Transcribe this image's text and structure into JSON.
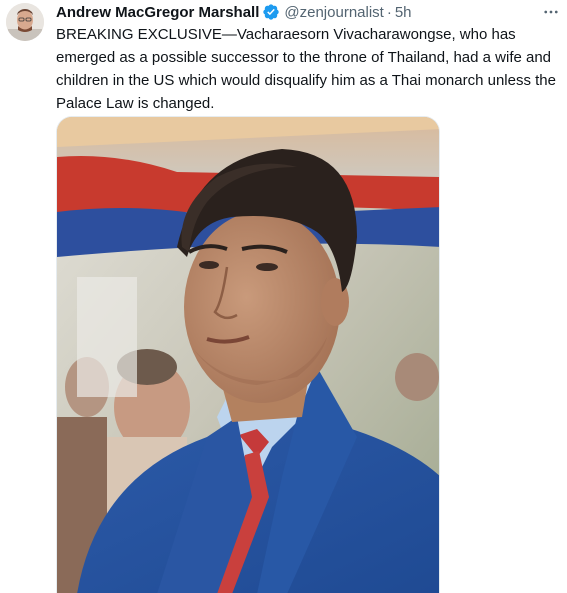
{
  "tweet": {
    "display_name": "Andrew MacGregor Marshall",
    "handle": "@zenjournalist",
    "separator": "·",
    "time": "5h",
    "text": "BREAKING EXCLUSIVE—Vacharaesorn Vivacharawongse, who has emerged as a possible successor to the throne of Thailand, had a wife and children in the US which would disqualify him as a Thai monarch unless the Palace Law is changed.",
    "verified": true,
    "more_icon": "more-horizontal-icon"
  },
  "colors": {
    "name_text": "#0f1419",
    "secondary_text": "#536471",
    "verified_blue": "#1d9bf0"
  }
}
